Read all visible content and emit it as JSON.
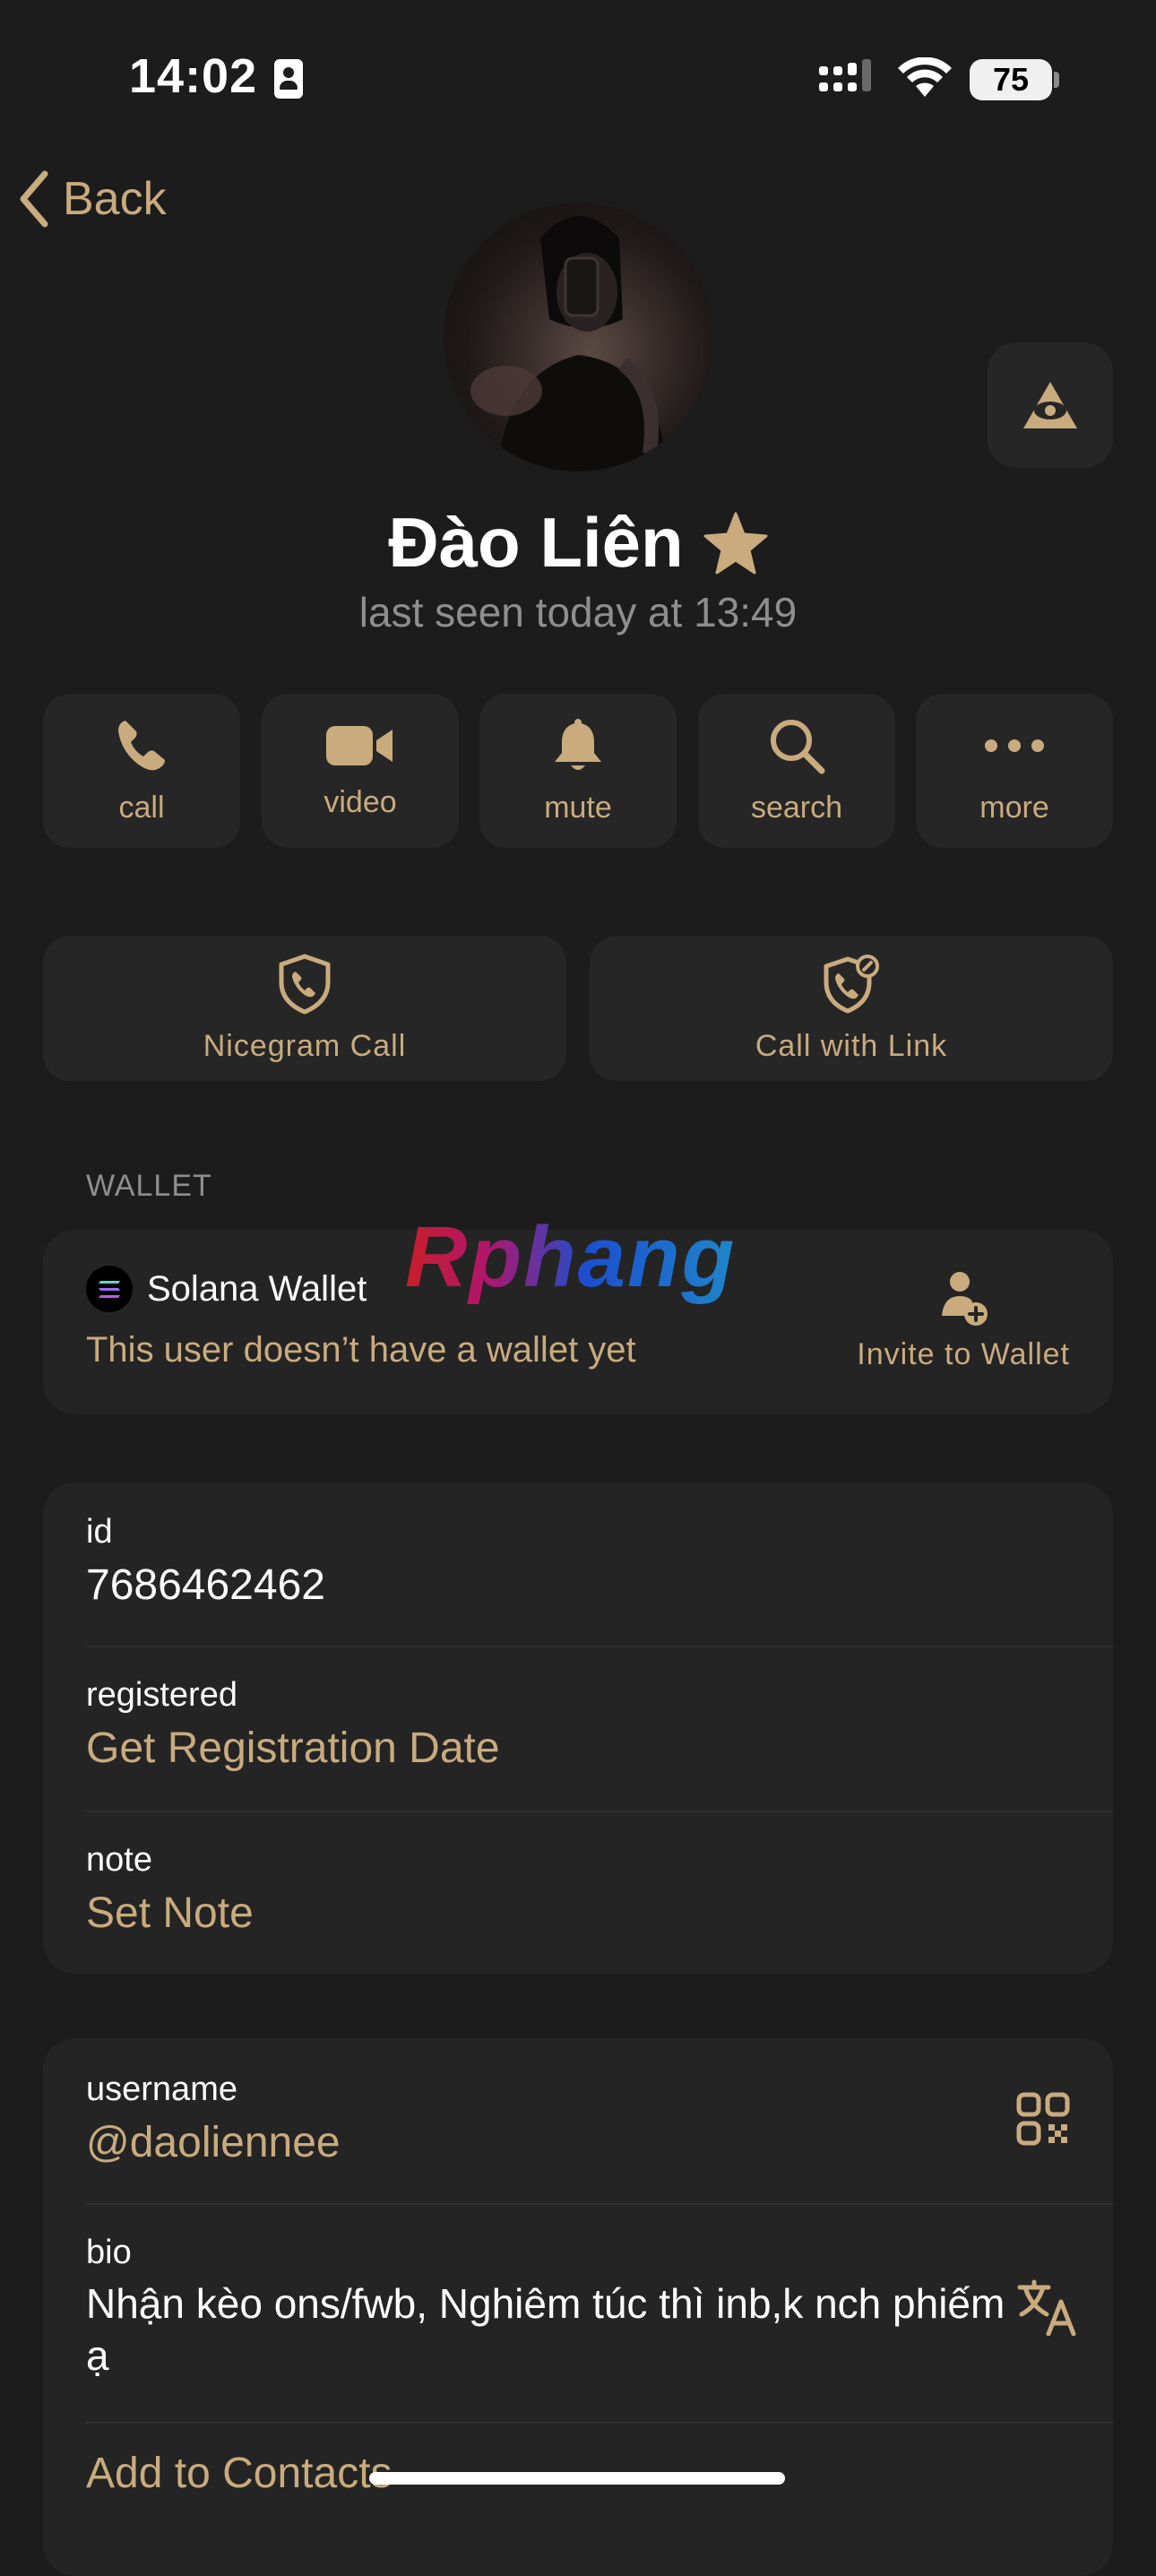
{
  "status_bar": {
    "time": "14:02",
    "battery": "75"
  },
  "nav": {
    "back_label": "Back"
  },
  "profile": {
    "name": "Đào Liên",
    "last_seen": "last seen today at 13:49"
  },
  "actions": [
    {
      "label": "call",
      "icon": "phone-icon"
    },
    {
      "label": "video",
      "icon": "video-camera-icon"
    },
    {
      "label": "mute",
      "icon": "bell-icon"
    },
    {
      "label": "search",
      "icon": "search-icon"
    },
    {
      "label": "more",
      "icon": "more-dots-icon"
    }
  ],
  "calls": {
    "nicegram_call": "Nicegram Call",
    "call_with_link": "Call with Link"
  },
  "wallet": {
    "header": "WALLET",
    "title": "Solana Wallet",
    "subtitle": "This user doesn’t have a wallet yet",
    "invite_label": "Invite to Wallet"
  },
  "watermark": "Rphang",
  "info": {
    "id_label": "id",
    "id_value": "7686462462",
    "registered_label": "registered",
    "registered_value": "Get Registration Date",
    "note_label": "note",
    "note_value": "Set Note"
  },
  "details": {
    "username_label": "username",
    "username_value": "@daoliennee",
    "bio_label": "bio",
    "bio_value": "Nhận kèo ons/fwb, Nghiêm túc thì inb,k nch phiếm ạ",
    "add_to_contacts": "Add to Contacts"
  },
  "colors": {
    "accent": "#c9ab7e",
    "background": "#1c1c1c",
    "card": "#242424",
    "muted": "#8e8e8e"
  }
}
